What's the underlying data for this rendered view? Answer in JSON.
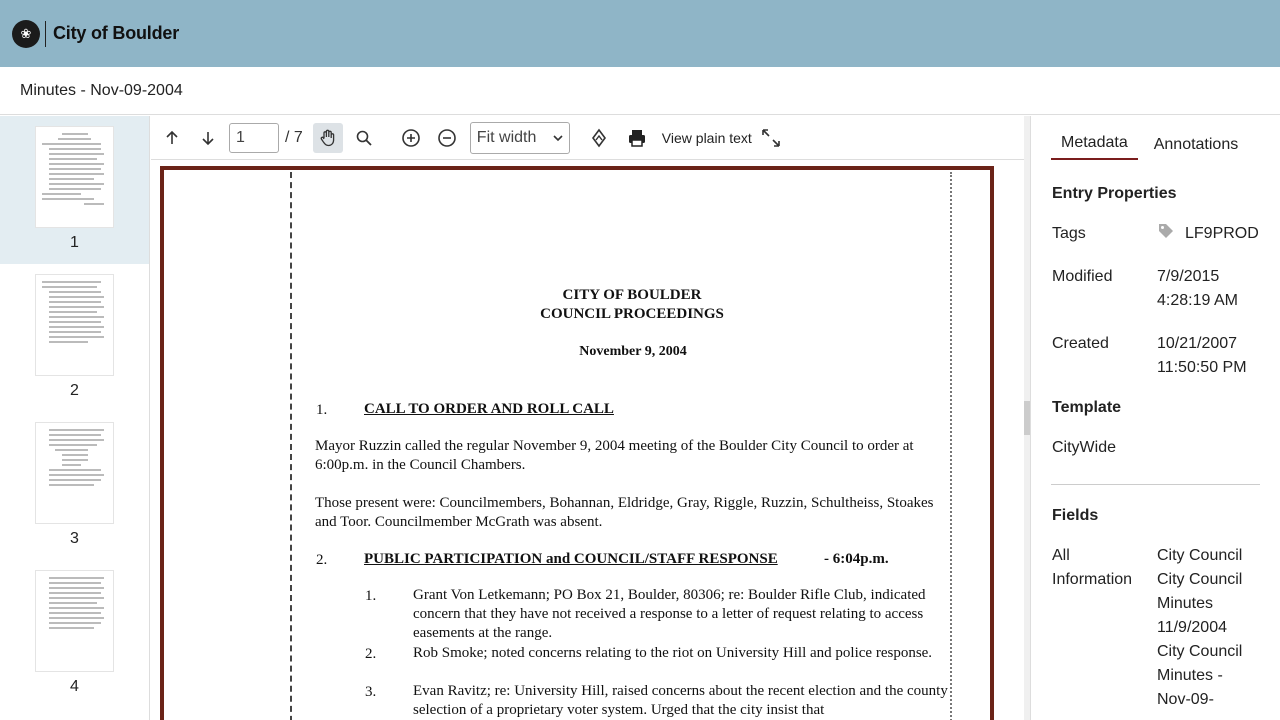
{
  "header": {
    "brand": "City of Boulder"
  },
  "document": {
    "title": "Minutes - Nov-09-2004"
  },
  "thumbnails": [
    {
      "number": "1",
      "selected": true
    },
    {
      "number": "2"
    },
    {
      "number": "3"
    },
    {
      "number": "4"
    }
  ],
  "toolbar": {
    "current_page": "1",
    "total_pages": "/ 7",
    "zoom": "Fit width",
    "plain_text_label": "View plain text",
    "icons": [
      "arrow-up-icon",
      "arrow-down-icon",
      "hand-pan-icon",
      "magnifier-icon",
      "zoom-in-icon",
      "zoom-out-icon",
      "rotate-icon",
      "print-icon",
      "fullscreen-icon"
    ]
  },
  "page": {
    "org": "CITY OF BOULDER",
    "heading": "COUNCIL PROCEEDINGS",
    "date": "November 9, 2004",
    "s1_num": "1.",
    "s1_head": "CALL TO ORDER AND ROLL CALL",
    "s1_text": "Mayor Ruzzin called the regular November 9, 2004 meeting of the Boulder City Council to order at 6:00p.m. in the Council Chambers.",
    "present_text": "Those present were:  Councilmembers, Bohannan, Eldridge, Gray, Riggle, Ruzzin, Schultheiss, Stoakes and Toor.  Councilmember McGrath was absent.",
    "s2_num": "2.",
    "s2_head": "PUBLIC PARTICIPATION and COUNCIL/STAFF RESPONSE",
    "s2_time": "- 6:04p.m.",
    "items": [
      {
        "num": "1.",
        "text": "Grant Von Letkemann; PO Box 21, Boulder, 80306; re: Boulder Rifle Club, indicated concern that they have not received a response to a letter of request relating to access easements at the range."
      },
      {
        "num": "2.",
        "text": "Rob Smoke; noted concerns relating to the riot on University Hill and police response."
      },
      {
        "num": "3.",
        "text": "Evan Ravitz; re: University Hill, raised concerns about the recent election and the county selection of a proprietary voter system.  Urged that the city insist that"
      }
    ]
  },
  "panel": {
    "tabs": [
      "Metadata",
      "Annotations"
    ],
    "entry_properties": "Entry Properties",
    "tags_label": "Tags",
    "tags_value": "LF9PROD",
    "modified_label": "Modified",
    "modified_date": "7/9/2015",
    "modified_time": "4:28:19 AM",
    "created_label": "Created",
    "created_date": "10/21/2007",
    "created_time": "11:50:50 PM",
    "template_title": "Template",
    "template_value": "CityWide",
    "fields_title": "Fields",
    "fields_label_1": "All",
    "fields_label_2": "Information",
    "fields_values": [
      "City Council",
      "City Council",
      "Minutes",
      "11/9/2004",
      "City Council",
      "Minutes -",
      "Nov-09-"
    ]
  },
  "colors": {
    "header_bg": "#8fb5c7",
    "accent": "#7a1d1d",
    "page_border": "#6b2318",
    "thumb_selected": "#e3edf2"
  }
}
